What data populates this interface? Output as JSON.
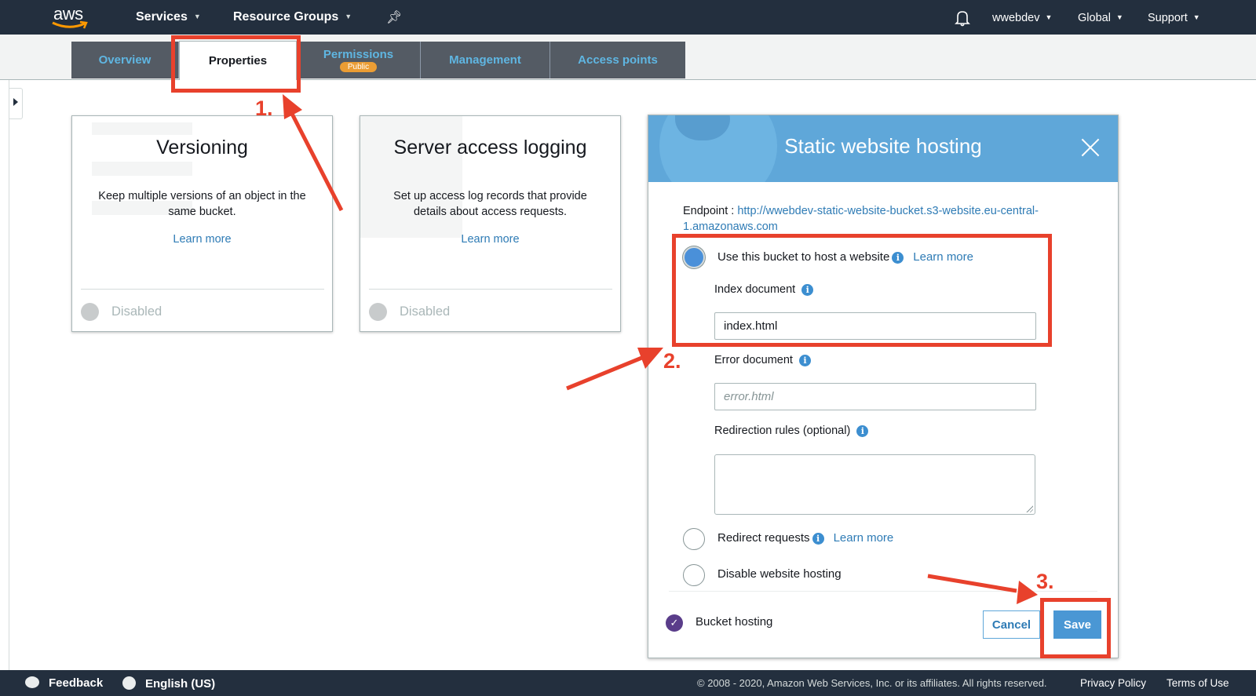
{
  "topnav": {
    "logo": "aws",
    "services": "Services",
    "resource_groups": "Resource Groups",
    "pin_icon": "pin-icon",
    "bell_icon": "bell-icon",
    "account": "wwebdev",
    "region": "Global",
    "support": "Support"
  },
  "tabs": [
    {
      "label": "Overview",
      "active": false
    },
    {
      "label": "Properties",
      "active": true
    },
    {
      "label": "Permissions",
      "badge": "Public",
      "active": false
    },
    {
      "label": "Management",
      "active": false
    },
    {
      "label": "Access points",
      "active": false
    }
  ],
  "cards": [
    {
      "title": "Versioning",
      "description": "Keep multiple versions of an object in the same bucket.",
      "link": "Learn more",
      "status": "Disabled"
    },
    {
      "title": "Server access logging",
      "description": "Set up access log records that provide details about access requests.",
      "link": "Learn more",
      "status": "Disabled"
    }
  ],
  "modal": {
    "title": "Static website hosting",
    "endpoint_label": "Endpoint : ",
    "endpoint_url": "http://wwebdev-static-website-bucket.s3-website.eu-central-1.amazonaws.com",
    "options": [
      {
        "label": "Use this bucket to host a website",
        "link": "Learn more",
        "selected": true
      },
      {
        "label": "Redirect requests",
        "link": "Learn more",
        "selected": false
      },
      {
        "label": "Disable website hosting",
        "selected": false
      }
    ],
    "index_document_label": "Index document",
    "index_document_value": "index.html",
    "error_document_label": "Error document",
    "error_document_placeholder": "error.html",
    "redirection_rules_label": "Redirection rules (optional)",
    "redirection_rules_value": "",
    "bucket_hosting_label": "Bucket hosting",
    "cancel": "Cancel",
    "save": "Save"
  },
  "annotations": {
    "step1": "1.",
    "step2": "2.",
    "step3": "3.",
    "color": "#e8412c"
  },
  "footer": {
    "feedback": "Feedback",
    "language": "English (US)",
    "copyright": "© 2008 - 2020, Amazon Web Services, Inc. or its affiliates. All rights reserved.",
    "privacy": "Privacy Policy",
    "terms": "Terms of Use"
  }
}
